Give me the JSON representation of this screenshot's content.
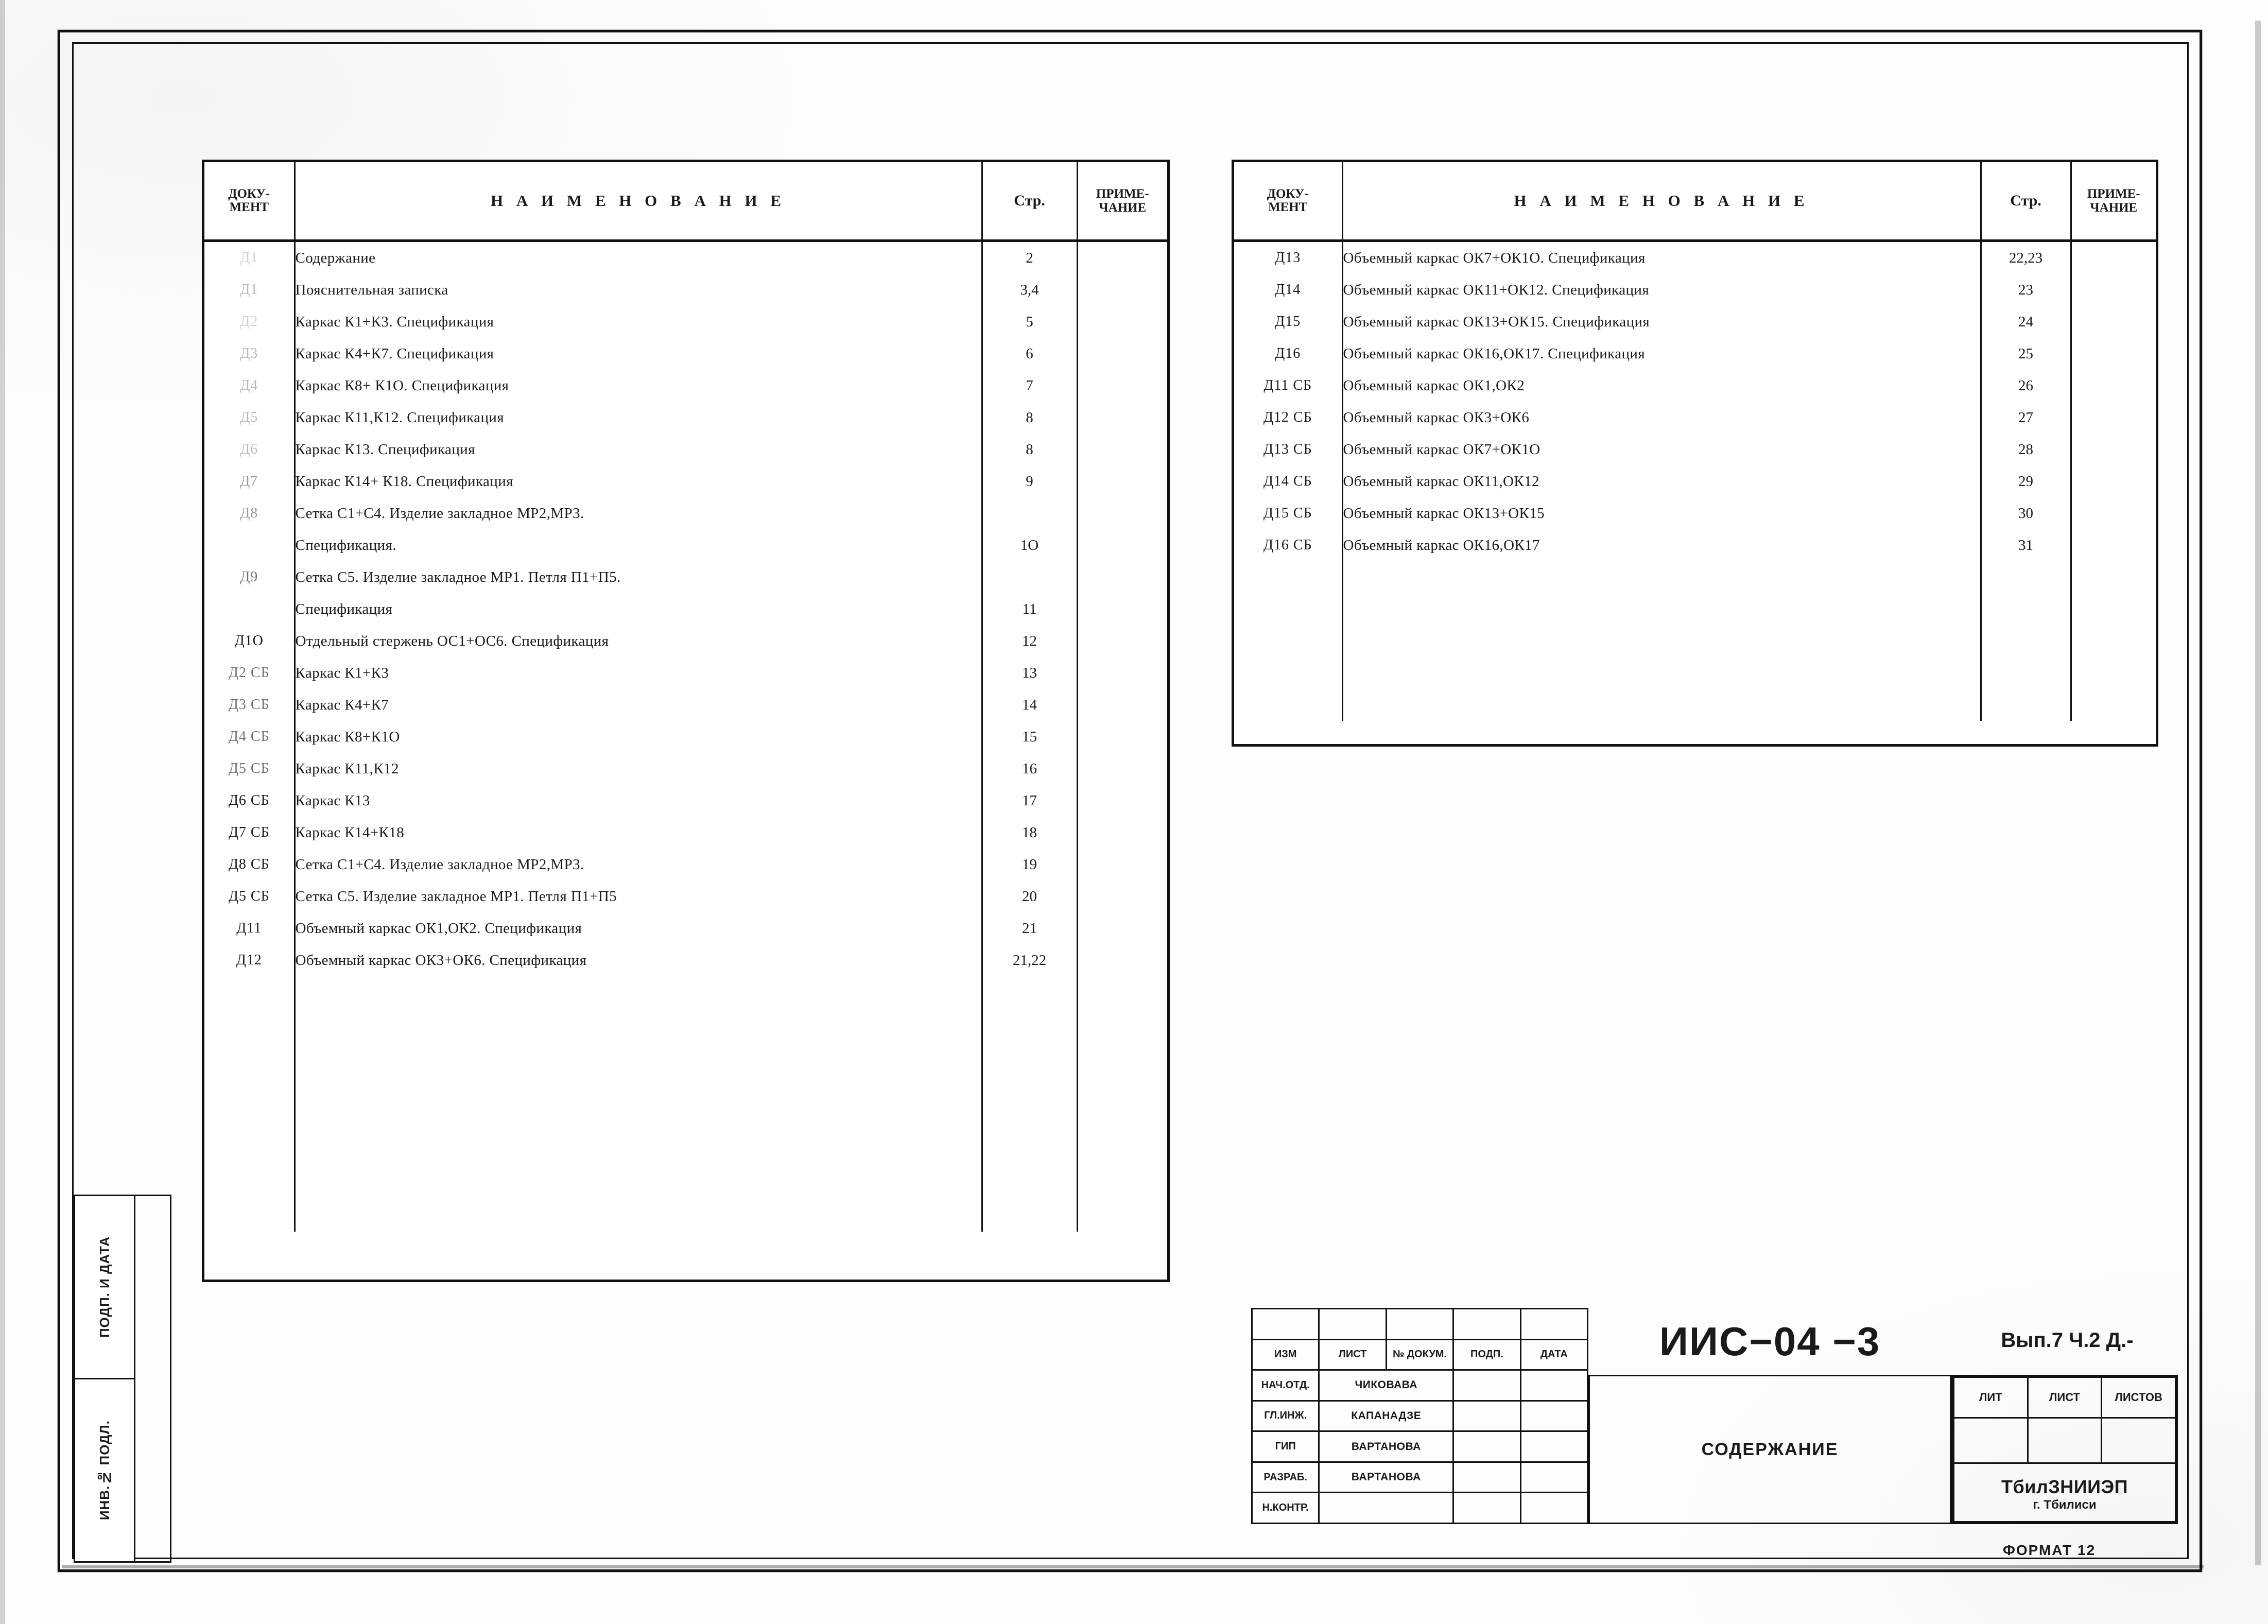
{
  "sheet": {
    "side_labels": [
      "ПОДП. И ДАТА",
      "ИНВ.№ ПОДЛ."
    ],
    "format_note": "ФОРМАТ 12"
  },
  "table_headers": {
    "doc": "ДОКУ-\nМЕНТ",
    "doc_line1": "ДОКУ-",
    "doc_line2": "МЕНТ",
    "name": "Н А И М Е Н О В А Н И Е",
    "page": "Стр.",
    "note_line1": "ПРИМЕ-",
    "note_line2": "ЧАНИЕ"
  },
  "toc_left": [
    {
      "doc": "Д1",
      "name": "Содержание",
      "page": "2",
      "note": "",
      "fade": "fade1"
    },
    {
      "doc": "Д1",
      "name": "Пояснительная записка",
      "page": "3,4",
      "note": "",
      "fade": "fade2"
    },
    {
      "doc": "Д2",
      "name": "Каркас К1+К3. Спецификация",
      "page": "5",
      "note": "",
      "fade": "fade1"
    },
    {
      "doc": "Д3",
      "name": "Каркас К4+К7. Спецификация",
      "page": "6",
      "note": "",
      "fade": "fade2"
    },
    {
      "doc": "Д4",
      "name": "Каркас К8+ К1О. Спецификация",
      "page": "7",
      "note": "",
      "fade": "fade2"
    },
    {
      "doc": "Д5",
      "name": "Каркас К11,К12. Спецификация",
      "page": "8",
      "note": "",
      "fade": "fade2"
    },
    {
      "doc": "Д6",
      "name": "Каркас К13. Спецификация",
      "page": "8",
      "note": "",
      "fade": "fade2"
    },
    {
      "doc": "Д7",
      "name": "Каркас К14+ К18. Спецификация",
      "page": "9",
      "note": "",
      "fade": "fade3"
    },
    {
      "doc": "Д8",
      "name": "Сетка С1+С4. Изделие закладное МР2,МР3.",
      "page": "",
      "note": "",
      "fade": "fade3"
    },
    {
      "doc": "",
      "name": "Спецификация.",
      "page": "1О",
      "note": "",
      "fade": ""
    },
    {
      "doc": "Д9",
      "name": "Сетка С5. Изделие закладное МР1. Петля П1+П5.",
      "page": "",
      "note": "",
      "fade": "fade4"
    },
    {
      "doc": "",
      "name": "Спецификация",
      "page": "11",
      "note": "",
      "fade": ""
    },
    {
      "doc": "Д1О",
      "name": "Отдельный стержень ОС1+ОС6. Спецификация",
      "page": "12",
      "note": "",
      "fade": ""
    },
    {
      "doc": "Д2 СБ",
      "name": "Каркас К1+К3",
      "page": "13",
      "note": "",
      "fade": "fade4"
    },
    {
      "doc": "Д3 СБ",
      "name": "Каркас К4+К7",
      "page": "14",
      "note": "",
      "fade": "fade4"
    },
    {
      "doc": "Д4 СБ",
      "name": "Каркас К8+К1О",
      "page": "15",
      "note": "",
      "fade": "fade4"
    },
    {
      "doc": "Д5 СБ",
      "name": "Каркас К11,К12",
      "page": "16",
      "note": "",
      "fade": "fade4"
    },
    {
      "doc": "Д6 СБ",
      "name": "Каркас К13",
      "page": "17",
      "note": "",
      "fade": ""
    },
    {
      "doc": "Д7 СБ",
      "name": "Каркас К14+К18",
      "page": "18",
      "note": "",
      "fade": ""
    },
    {
      "doc": "Д8 СБ",
      "name": "Сетка С1+С4. Изделие закладное МР2,МР3.",
      "page": "19",
      "note": "",
      "fade": ""
    },
    {
      "doc": "Д5 СБ",
      "name": "Сетка С5. Изделие закладное МР1. Петля П1+П5",
      "page": "20",
      "note": "",
      "fade": ""
    },
    {
      "doc": "Д11",
      "name": "Объемный каркас ОК1,ОК2. Спецификация",
      "page": "21",
      "note": "",
      "fade": ""
    },
    {
      "doc": "Д12",
      "name": "Объемный каркас ОК3+ОК6. Спецификация",
      "page": "21,22",
      "note": "",
      "fade": ""
    }
  ],
  "toc_right": [
    {
      "doc": "Д13",
      "name": "Объемный каркас ОК7+ОК1О. Спецификация",
      "page": "22,23",
      "note": ""
    },
    {
      "doc": "Д14",
      "name": "Объемный каркас ОК11+ОК12. Спецификация",
      "page": "23",
      "note": ""
    },
    {
      "doc": "Д15",
      "name": "Объемный каркас ОК13+ОК15. Спецификация",
      "page": "24",
      "note": ""
    },
    {
      "doc": "Д16",
      "name": "Объемный каркас ОК16,ОК17. Спецификация",
      "page": "25",
      "note": ""
    },
    {
      "doc": "Д11 СБ",
      "name": "Объемный каркас ОК1,ОК2",
      "page": "26",
      "note": ""
    },
    {
      "doc": "Д12 СБ",
      "name": "Объемный каркас ОК3+ОК6",
      "page": "27",
      "note": ""
    },
    {
      "doc": "Д13 СБ",
      "name": "Объемный каркас ОК7+ОК1О",
      "page": "28",
      "note": ""
    },
    {
      "doc": "Д14 СБ",
      "name": "Объемный каркас ОК11,ОК12",
      "page": "29",
      "note": ""
    },
    {
      "doc": "Д15 СБ",
      "name": "Объемный каркас ОК13+ОК15",
      "page": "30",
      "note": ""
    },
    {
      "doc": "Д16 СБ",
      "name": "Объемный каркас ОК16,ОК17",
      "page": "31",
      "note": ""
    }
  ],
  "title_block": {
    "doc_code": "ИИС−04 −3",
    "issue": "Вып.7 Ч.2 Д.-",
    "sheet_title": "СОДЕРЖАНИЕ",
    "organization": "ТбилЗНИИЭП",
    "city": "г. Тбилиси",
    "rev_headers": [
      "ИЗМ",
      "ЛИСТ",
      "№ ДОКУМ.",
      "ПОДП.",
      "ДАТА"
    ],
    "roles": [
      {
        "role": "НАЧ.ОТД.",
        "name": "ЧИКОВАВА"
      },
      {
        "role": "ГЛ.ИНЖ.",
        "name": "КАПАНАДЗЕ"
      },
      {
        "role": "ГИП",
        "name": "ВАРТАНОВА"
      },
      {
        "role": "РАЗРАБ.",
        "name": "ВАРТАНОВА"
      },
      {
        "role": "Н.КОНТР.",
        "name": ""
      }
    ],
    "sheet_headers": [
      "ЛИТ",
      "ЛИСТ",
      "ЛИСТОВ"
    ],
    "sheet_values": [
      "",
      "",
      ""
    ]
  }
}
